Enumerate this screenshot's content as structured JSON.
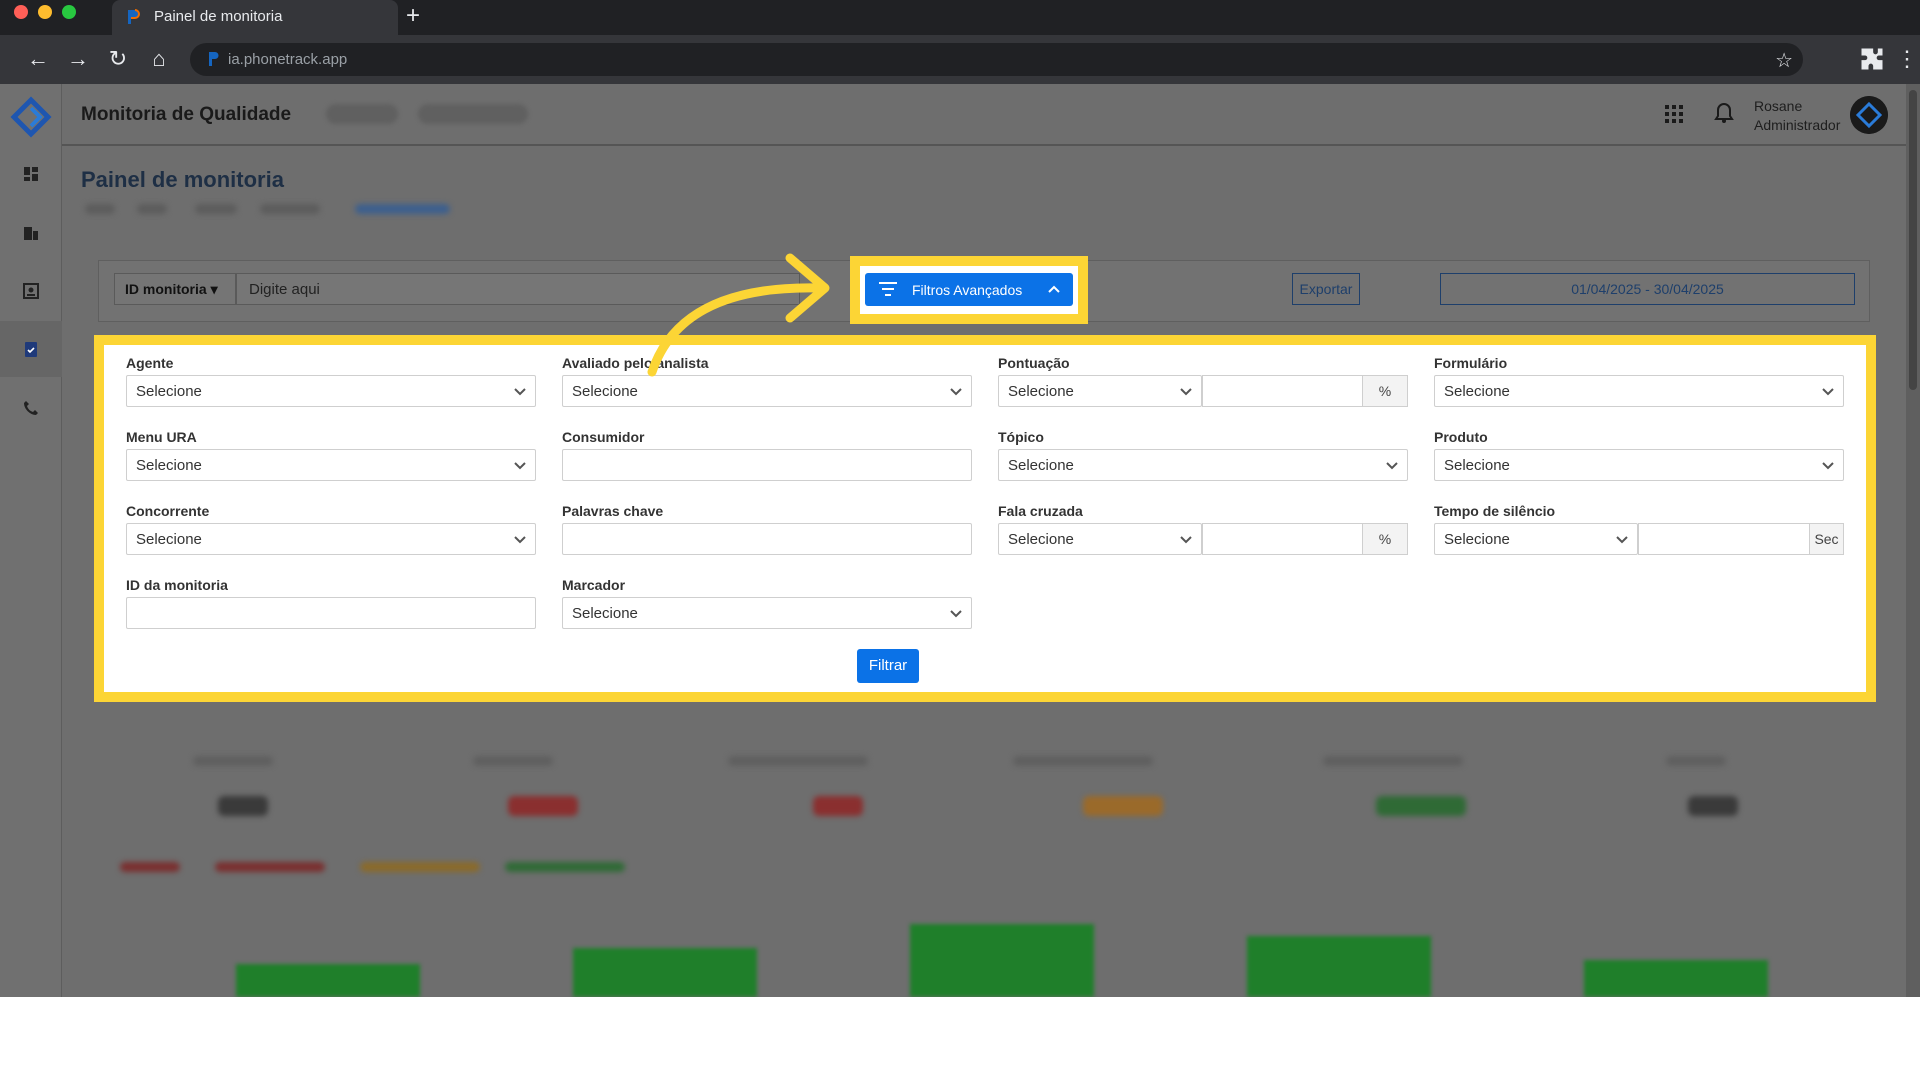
{
  "browser": {
    "tab_title": "Painel de monitoria",
    "url": "ia.phonetrack.app"
  },
  "app": {
    "title": "Monitoria de Qualidade",
    "user_name": "Rosane",
    "user_role": "Administrador",
    "page_title": "Painel de monitoria"
  },
  "search": {
    "type_label": "ID monitoria",
    "placeholder": "Digite aqui",
    "advanced_label": "Filtros Avançados",
    "export_label": "Exportar",
    "date_range": "01/04/2025 - 30/04/2025"
  },
  "filters": {
    "agente": {
      "label": "Agente",
      "value": "Selecione"
    },
    "avaliado": {
      "label": "Avaliado pelo analista",
      "value": "Selecione"
    },
    "pontuacao": {
      "label": "Pontuação",
      "value": "Selecione",
      "suffix": "%"
    },
    "formulario": {
      "label": "Formulário",
      "value": "Selecione"
    },
    "menu_ura": {
      "label": "Menu URA",
      "value": "Selecione"
    },
    "consumidor": {
      "label": "Consumidor"
    },
    "topico": {
      "label": "Tópico",
      "value": "Selecione"
    },
    "produto": {
      "label": "Produto",
      "value": "Selecione"
    },
    "concorrente": {
      "label": "Concorrente",
      "value": "Selecione"
    },
    "palavras_chave": {
      "label": "Palavras chave"
    },
    "fala_cruzada": {
      "label": "Fala cruzada",
      "value": "Selecione",
      "suffix": "%"
    },
    "tempo_silencio": {
      "label": "Tempo de silêncio",
      "value": "Selecione",
      "suffix": "Sec"
    },
    "id_monitoria": {
      "label": "ID da monitoria"
    },
    "marcador": {
      "label": "Marcador",
      "value": "Selecione"
    },
    "submit_label": "Filtrar"
  },
  "colors": {
    "accent": "#0b72e7",
    "highlight": "#fcd535",
    "chart_bar": "#1f7f2a"
  }
}
